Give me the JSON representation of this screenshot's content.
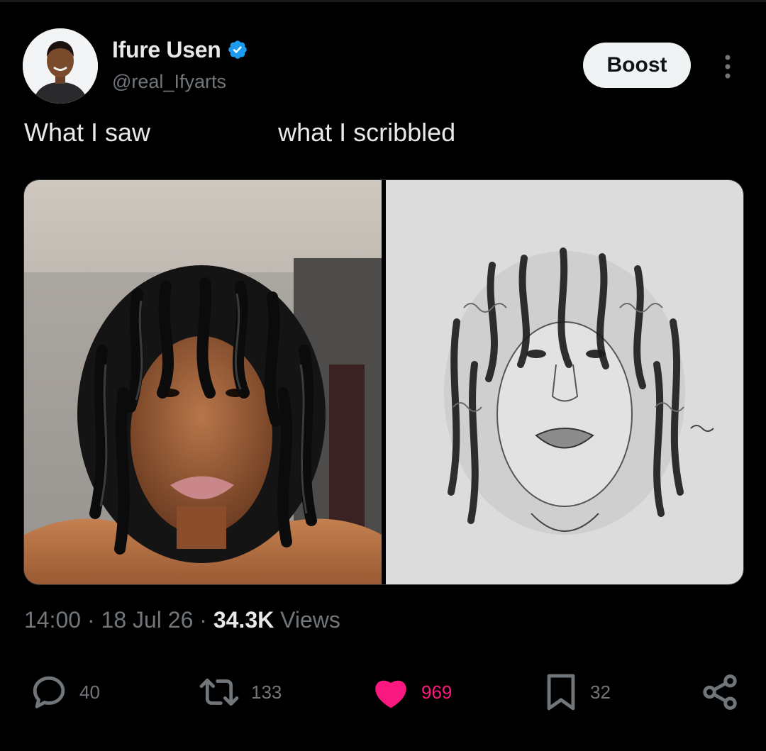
{
  "author": {
    "display_name": "Ifure Usen",
    "handle": "@real_Ifyarts",
    "verified": true,
    "avatar_icon": "user-avatar"
  },
  "header": {
    "boost_label": "Boost",
    "more_icon": "more-vertical-icon"
  },
  "tweet": {
    "text": "What I saw                  what I scribbled",
    "media": [
      {
        "kind": "photo",
        "subject": "photo-of-woman-with-twists"
      },
      {
        "kind": "photo",
        "subject": "pencil-sketch-portrait"
      }
    ],
    "time": "14:00",
    "separator": "·",
    "date": "18 Jul 26",
    "views_count": "34.3K",
    "views_label": "Views"
  },
  "actions": {
    "reply": {
      "icon": "reply-icon",
      "count": "40"
    },
    "retweet": {
      "icon": "retweet-icon",
      "count": "133"
    },
    "like": {
      "icon": "heart-icon",
      "count": "969",
      "liked": true
    },
    "bookmark": {
      "icon": "bookmark-icon",
      "count": "32"
    },
    "share": {
      "icon": "share-icon"
    }
  },
  "colors": {
    "background": "#000000",
    "text": "#e7e9ea",
    "muted": "#71767b",
    "like": "#f91880",
    "verified": "#1d9bf0"
  }
}
